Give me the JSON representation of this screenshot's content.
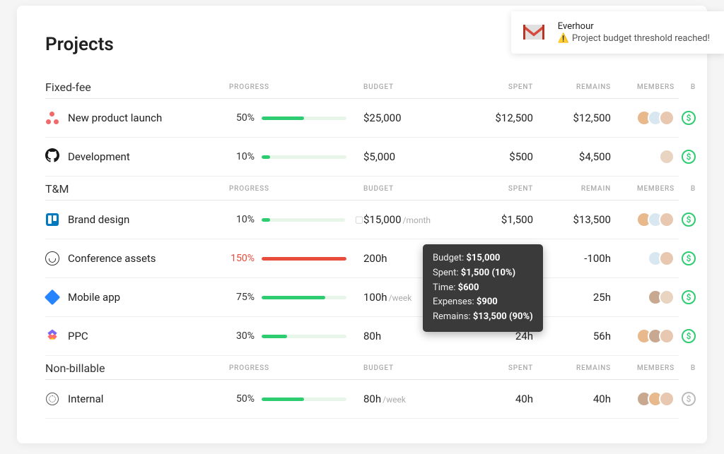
{
  "page_title": "Projects",
  "columns": {
    "progress": "PROGRESS",
    "budget": "BUDGET",
    "spent": "SPENT",
    "remains": "REMAINS",
    "remain": "REMAIN",
    "members": "MEMBERS",
    "billing": "B"
  },
  "sections": [
    {
      "title": "Fixed-fee",
      "remains_label": "REMAINS",
      "rows": [
        {
          "icon": "asana",
          "name": "New product launch",
          "pct": "50%",
          "fill": 50,
          "over": false,
          "budget": "$25,000",
          "suffix": "",
          "spent": "$12,500",
          "remains": "$12,500",
          "avatars": [
            "#e8b98c",
            "#d9e8f0",
            "#e8c8b0"
          ],
          "billable": true,
          "folder": false
        },
        {
          "icon": "github",
          "name": "Development",
          "pct": "10%",
          "fill": 10,
          "over": false,
          "budget": "$5,000",
          "suffix": "",
          "spent": "$500",
          "remains": "$4,500",
          "avatars": [
            "#e8d4c0"
          ],
          "billable": true,
          "folder": false
        }
      ]
    },
    {
      "title": "T&M",
      "remains_label": "REMAIN",
      "rows": [
        {
          "icon": "trello",
          "name": "Brand design",
          "pct": "10%",
          "fill": 10,
          "over": false,
          "budget": "$15,000",
          "suffix": "/month",
          "spent": "$1,500",
          "remains": "$13,500",
          "avatars": [
            "#e8b98c",
            "#d9e8f0",
            "#e8c8b0"
          ],
          "billable": true,
          "folder": true
        },
        {
          "icon": "basecamp",
          "name": "Conference assets",
          "pct": "150%",
          "fill": 100,
          "over": true,
          "budget": "200h",
          "suffix": "",
          "spent": "",
          "remains": "-100h",
          "avatars": [
            "#d9e8f0",
            "#e8c8b0"
          ],
          "billable": true,
          "folder": false
        },
        {
          "icon": "jira",
          "name": "Mobile app",
          "pct": "75%",
          "fill": 75,
          "over": false,
          "budget": "100h",
          "suffix": "/week",
          "spent": "",
          "remains": "25h",
          "avatars": [
            "#c8a890",
            "#e8d4c0"
          ],
          "billable": true,
          "folder": false
        },
        {
          "icon": "clickup",
          "name": "PPC",
          "pct": "30%",
          "fill": 30,
          "over": false,
          "budget": "80h",
          "suffix": "",
          "spent": "24h",
          "remains": "56h",
          "avatars": [
            "#e8b98c",
            "#c8a890",
            "#e8c8b0"
          ],
          "billable": true,
          "folder": false
        }
      ]
    },
    {
      "title": "Non-billable",
      "remains_label": "REMAINS",
      "rows": [
        {
          "icon": "internal",
          "name": "Internal",
          "pct": "50%",
          "fill": 50,
          "over": false,
          "budget": "80h",
          "suffix": "/week",
          "spent": "40h",
          "remains": "40h",
          "avatars": [
            "#c8a890",
            "#e8b98c",
            "#e8c8b0"
          ],
          "billable": false,
          "folder": false
        }
      ]
    }
  ],
  "tooltip": {
    "budget_label": "Budget:",
    "budget": "$15,000",
    "spent_label": "Spent:",
    "spent": "$1,500 (10%)",
    "time_label": "Time:",
    "time": "$600",
    "expenses_label": "Expenses:",
    "expenses": "$900",
    "remains_label": "Remains:",
    "remains": "$13,500 (90%)"
  },
  "notification": {
    "sender": "Everhour",
    "message": "Project budget threshold reached!"
  }
}
